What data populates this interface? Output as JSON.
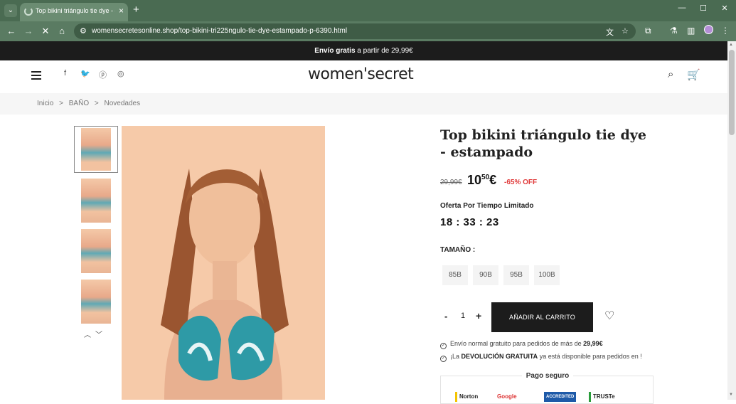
{
  "browser": {
    "tab_title": "Top bikini triángulo tie dye - es",
    "url": "womensecretesonline.shop/top-bikini-tri225ngulo-tie-dye-estampado-p-6390.html"
  },
  "promo": {
    "bold": "Envío gratis",
    "rest": " a partir de 29,99€"
  },
  "header": {
    "logo": "women'secret"
  },
  "breadcrumb": [
    "Inicio",
    ">",
    "BAÑO",
    ">",
    "Novedades"
  ],
  "product": {
    "title": "Top bikini triángulo tie dye - estampado",
    "old_price": "29,99€",
    "price_int": "10",
    "price_dec": "50",
    "price_cur": "€",
    "discount": "-65% OFF",
    "offer_label": "Oferta Por Tiempo Limitado",
    "countdown": "18 : 33 : 23",
    "size_label": "TAMAÑO :",
    "sizes": [
      "85B",
      "90B",
      "95B",
      "100B"
    ],
    "qty": "1",
    "qty_minus": "-",
    "qty_plus": "+",
    "add_to_cart": "AÑADIR AL CARRITO",
    "info1_pre": "Envío normal gratuito para pedidos de más de ",
    "info1_bold": "29,99€",
    "info2_pre": "¡La ",
    "info2_bold": "DEVOLUCIÓN GRATUITA",
    "info2_post": " ya está disponible para pedidos en !",
    "secure_title": "Pago seguro",
    "badges": [
      "Norton",
      "Google",
      "ACCREDITED",
      "TRUSTe"
    ]
  },
  "icons": {
    "menu": "hamburger-icon",
    "social": [
      "facebook-icon",
      "twitter-icon",
      "pinterest-icon",
      "instagram-icon"
    ],
    "search": "search-icon",
    "cart": "cart-icon",
    "wishlist": "heart-icon"
  }
}
